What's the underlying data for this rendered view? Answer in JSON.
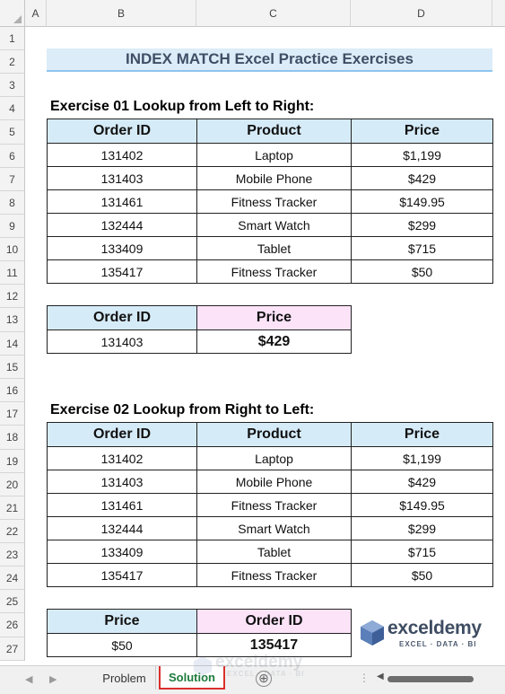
{
  "columns": [
    "A",
    "B",
    "C",
    "D"
  ],
  "rows": [
    "1",
    "2",
    "3",
    "4",
    "5",
    "6",
    "7",
    "8",
    "9",
    "10",
    "11",
    "12",
    "13",
    "14",
    "15",
    "16",
    "17",
    "18",
    "19",
    "20",
    "21",
    "22",
    "23",
    "24",
    "25",
    "26",
    "27"
  ],
  "title": "INDEX MATCH Excel Practice Exercises",
  "exercise1": {
    "label": "Exercise 01 Lookup from Left to Right:",
    "headers": [
      "Order ID",
      "Product",
      "Price"
    ],
    "rows": [
      [
        "131402",
        "Laptop",
        "$1,199"
      ],
      [
        "131403",
        "Mobile Phone",
        "$429"
      ],
      [
        "131461",
        "Fitness Tracker",
        "$149.95"
      ],
      [
        "132444",
        "Smart Watch",
        "$299"
      ],
      [
        "133409",
        "Tablet",
        "$715"
      ],
      [
        "135417",
        "Fitness Tracker",
        "$50"
      ]
    ],
    "lookup": {
      "headers": [
        "Order ID",
        "Price"
      ],
      "values": [
        "131403",
        "$429"
      ]
    }
  },
  "exercise2": {
    "label": "Exercise 02 Lookup from Right to Left:",
    "headers": [
      "Order ID",
      "Product",
      "Price"
    ],
    "rows": [
      [
        "131402",
        "Laptop",
        "$1,199"
      ],
      [
        "131403",
        "Mobile Phone",
        "$429"
      ],
      [
        "131461",
        "Fitness Tracker",
        "$149.95"
      ],
      [
        "132444",
        "Smart Watch",
        "$299"
      ],
      [
        "133409",
        "Tablet",
        "$715"
      ],
      [
        "135417",
        "Fitness Tracker",
        "$50"
      ]
    ],
    "lookup": {
      "headers": [
        "Price",
        "Order ID"
      ],
      "values": [
        "$50",
        "135417"
      ]
    }
  },
  "sheets": {
    "tabs": [
      "Problem",
      "Solution"
    ],
    "active": "Solution",
    "add_symbol": "⊕"
  },
  "logo": {
    "name": "exceldemy",
    "tagline": "EXCEL · DATA · BI"
  },
  "colors": {
    "header_blue": "#d6ebf8",
    "header_pink": "#fce3f8",
    "title_bg": "#dcecf8",
    "active_tab_border": "#d9302c",
    "active_tab_text": "#1e7b3c"
  }
}
